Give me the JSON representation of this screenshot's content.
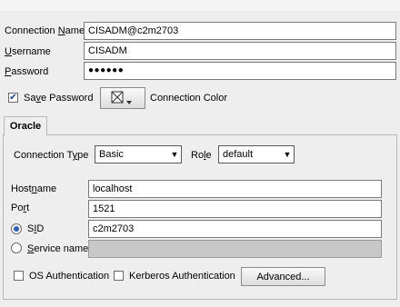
{
  "connection_name": {
    "label_pre": "Connection ",
    "label_mn": "N",
    "label_post": "ame",
    "value": "CISADM@c2m2703"
  },
  "username": {
    "label_mn": "U",
    "label_post": "sername",
    "value": "CISADM"
  },
  "password": {
    "label_mn": "P",
    "label_post": "assword",
    "value": "●●●●●●"
  },
  "save_password": {
    "label_pre": "Sa",
    "label_mn": "v",
    "label_post": "e Password",
    "checked": true
  },
  "connection_color": {
    "label": "Connection Color",
    "icon": "color-picker-icon"
  },
  "tab": {
    "label": "Oracle"
  },
  "connection_type": {
    "label_pre": "Connection T",
    "label_mn": "y",
    "label_post": "pe",
    "value": "Basic"
  },
  "role": {
    "label_pre": "Ro",
    "label_mn": "l",
    "label_post": "e",
    "value": "default"
  },
  "hostname": {
    "label_pre": "Host",
    "label_mn": "n",
    "label_post": "ame",
    "value": "localhost"
  },
  "port": {
    "label_pre": "Po",
    "label_mn": "r",
    "label_post": "t",
    "value": "1521"
  },
  "sid": {
    "label_pre": "S",
    "label_mn": "I",
    "label_post": "D",
    "value": "c2m2703",
    "selected": true
  },
  "service_name": {
    "label_mn": "S",
    "label_post": "ervice name",
    "value": "",
    "selected": false
  },
  "os_auth": {
    "label": "OS Authentication",
    "checked": false
  },
  "kerberos_auth": {
    "label": "Kerberos Authentication",
    "checked": false
  },
  "advanced_button": {
    "label": "Advanced..."
  },
  "colors": {
    "field_border": "#7a7a7a",
    "radio_dot": "#2c5fb0",
    "disabled_field": "#c8c8c8"
  }
}
